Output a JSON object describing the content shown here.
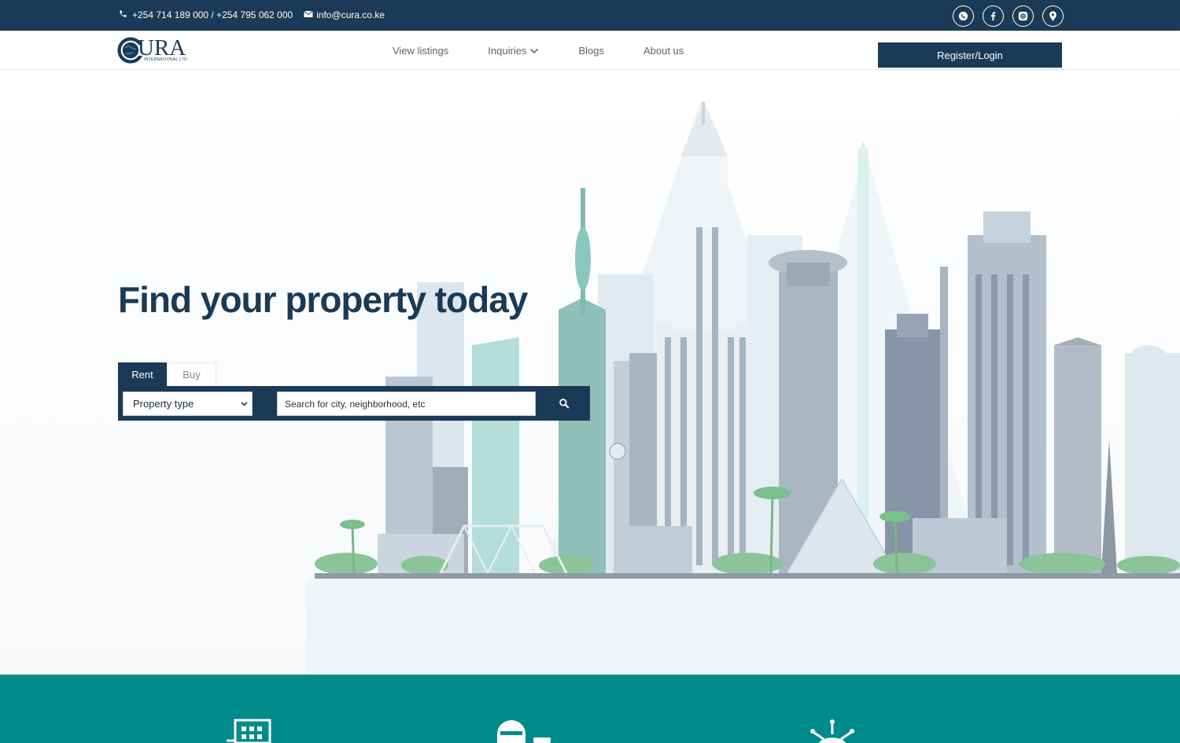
{
  "topbar": {
    "phone": "+254 714 189 000 / +254 795 062 000",
    "email": "info@cura.co.ke",
    "icons": [
      "phone-icon",
      "mail-icon"
    ],
    "socials": [
      "whatsapp-icon",
      "facebook-icon",
      "instagram-icon",
      "location-pin-icon"
    ]
  },
  "nav": {
    "logo_text": "URA",
    "logo_sub": "INTERNATIONAL LTD",
    "items": [
      "View listings",
      "Inquiries",
      "Blogs",
      "About us"
    ],
    "register_label": "Register/Login"
  },
  "hero": {
    "headline": "Find your property today",
    "tabs": [
      "Rent",
      "Buy"
    ],
    "active_tab": "Rent",
    "select_value": "Property type",
    "search_placeholder": "Search for city, neighborhood, etc"
  },
  "colors": {
    "navy": "#1a3a56",
    "teal": "#008b8b",
    "white": "#ffffff"
  }
}
